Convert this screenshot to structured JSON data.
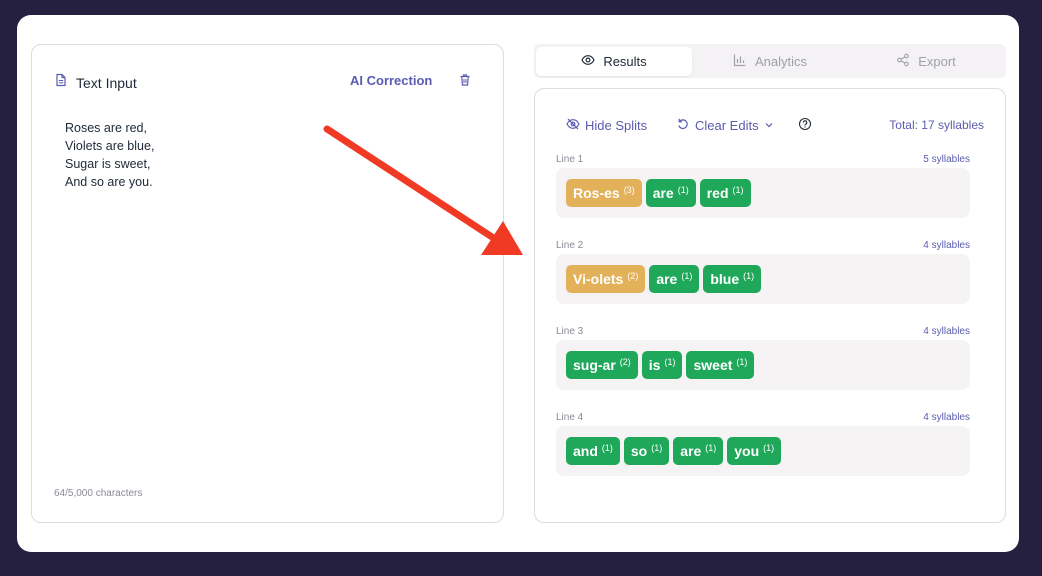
{
  "left": {
    "title": "Text Input",
    "ai_correction": "AI Correction",
    "text_lines": [
      "Roses are red,",
      "Violets are blue,",
      "Sugar is sweet,",
      "And so are you."
    ],
    "char_count": "64/5,000 characters"
  },
  "tabs": [
    {
      "label": "Results",
      "icon": "eye-icon",
      "active": true
    },
    {
      "label": "Analytics",
      "icon": "bar-chart-icon",
      "active": false
    },
    {
      "label": "Export",
      "icon": "share-icon",
      "active": false
    }
  ],
  "toolbar": {
    "hide_splits": "Hide Splits",
    "clear_edits": "Clear Edits",
    "total": "Total: 17 syllables"
  },
  "lines": [
    {
      "label": "Line 1",
      "count": "5 syllables",
      "words": [
        {
          "text": "Ros-es",
          "syl": "(3)",
          "color": "orange"
        },
        {
          "text": "are",
          "syl": "(1)",
          "color": "green"
        },
        {
          "text": "red",
          "syl": "(1)",
          "color": "green"
        }
      ]
    },
    {
      "label": "Line 2",
      "count": "4 syllables",
      "words": [
        {
          "text": "Vi-olets",
          "syl": "(2)",
          "color": "orange"
        },
        {
          "text": "are",
          "syl": "(1)",
          "color": "green"
        },
        {
          "text": "blue",
          "syl": "(1)",
          "color": "green"
        }
      ]
    },
    {
      "label": "Line 3",
      "count": "4 syllables",
      "words": [
        {
          "text": "sug-ar",
          "syl": "(2)",
          "color": "green"
        },
        {
          "text": "is",
          "syl": "(1)",
          "color": "green"
        },
        {
          "text": "sweet",
          "syl": "(1)",
          "color": "green"
        }
      ]
    },
    {
      "label": "Line 4",
      "count": "4 syllables",
      "words": [
        {
          "text": "and",
          "syl": "(1)",
          "color": "green"
        },
        {
          "text": "so",
          "syl": "(1)",
          "color": "green"
        },
        {
          "text": "are",
          "syl": "(1)",
          "color": "green"
        },
        {
          "text": "you",
          "syl": "(1)",
          "color": "green"
        }
      ]
    }
  ],
  "colors": {
    "accent": "#5b5bb0",
    "green": "#1fa85a",
    "orange": "#e3b15a",
    "arrow": "#f03a24",
    "frame": "#262040"
  }
}
